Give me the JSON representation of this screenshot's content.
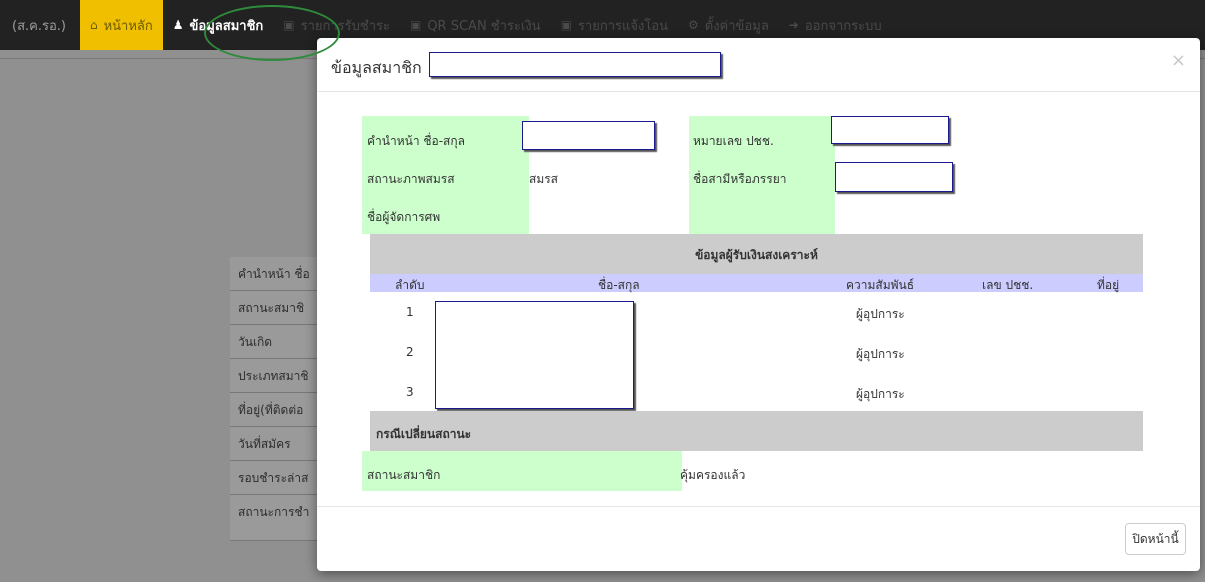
{
  "navbar": {
    "brand": "(ส.ค.รอ.)",
    "home_label": "หน้าหลัก",
    "member_label": "ข้อมูลสมาชิก",
    "payments_label": "รายการรับชำระ",
    "qr_label": "QR SCAN ชำระเงิน",
    "transfer_label": "รายการแจ้งโอน",
    "settings_label": "ตั้งค่าข้อมูล",
    "logout_label": "ออกจากระบบ"
  },
  "background_table": {
    "rows": [
      "คำนำหน้า ชื่อ",
      "สถานะสมาชิ",
      "วันเกิด",
      "ประเภทสมาชิ",
      "ที่อยู่(ที่ติดต่อ",
      "วันที่สมัคร",
      "รอบชำระล่าส",
      "สถานะการชำ"
    ]
  },
  "modal": {
    "title": "ข้อมูลสมาชิก",
    "close_glyph": "×",
    "fields": {
      "name_label": "คำนำหน้า ชื่อ-สกุล",
      "id_label": "หมายเลข ปชช.",
      "marital_label": "สถานะภาพสมรส",
      "marital_value": "สมรส",
      "spouse_label": "ชื่อสามีหรือภรรยา",
      "funeral_label": "ชื่อผู้จัดการศพ"
    },
    "beneficiary": {
      "section_title": "ข้อมูลผู้รับเงินสงเคราะห์",
      "columns": {
        "no": "ลำดับ",
        "name": "ชื่อ-สกุล",
        "relation": "ความสัมพันธ์",
        "id": "เลข ปชช.",
        "address": "ที่อยู่"
      },
      "rows": [
        {
          "no": "1",
          "relation": "ผู้อุปการะ"
        },
        {
          "no": "2",
          "relation": "ผู้อุปการะ"
        },
        {
          "no": "3",
          "relation": "ผู้อุปการะ"
        }
      ]
    },
    "status_change": {
      "section_title": "กรณีเปลี่ยนสถานะ",
      "status_label": "สถานะสมาชิก",
      "status_value": "คุ้มครองแล้ว"
    },
    "footer": {
      "close_button": "ปิดหน้านี้"
    }
  }
}
